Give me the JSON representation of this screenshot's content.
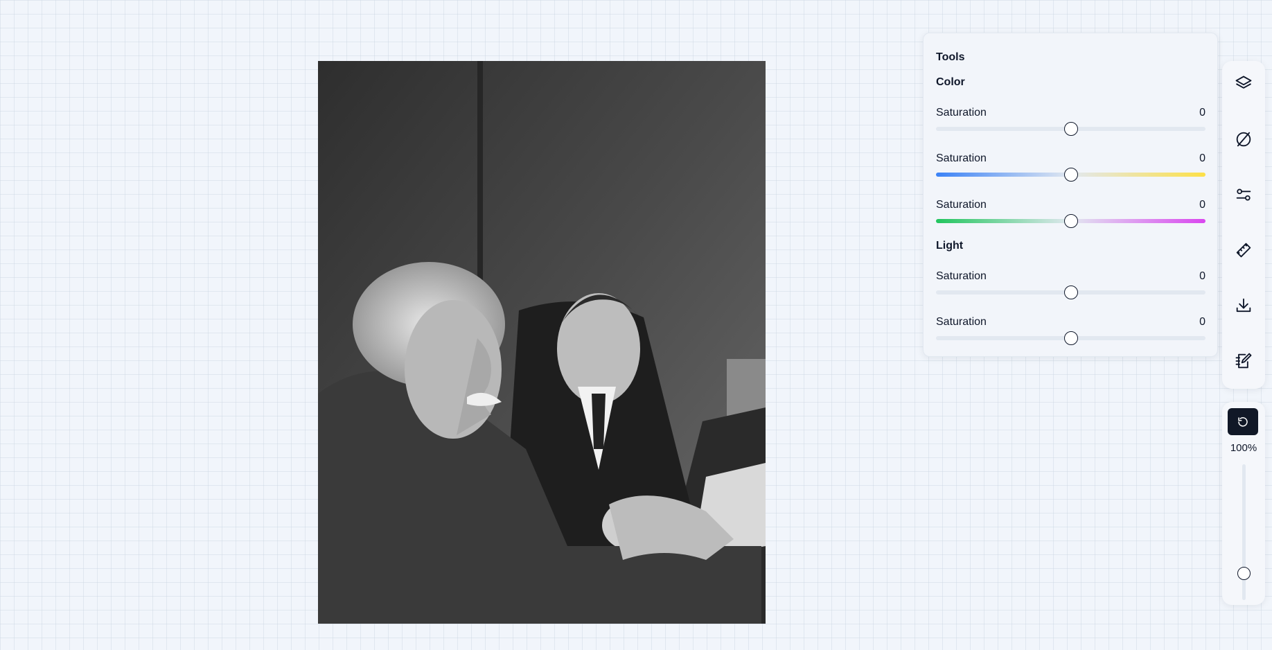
{
  "photo": {
    "alt": "Black and white photograph of two men seated at a desk reading papers"
  },
  "tools": {
    "title": "Tools",
    "sections": [
      {
        "title": "Color",
        "sliders": [
          {
            "label": "Saturation",
            "value": "0",
            "position": 0.5,
            "track": "neutral"
          },
          {
            "label": "Saturation",
            "value": "0",
            "position": 0.5,
            "track": "blue-yellow"
          },
          {
            "label": "Saturation",
            "value": "0",
            "position": 0.5,
            "track": "green-magenta"
          }
        ]
      },
      {
        "title": "Light",
        "sliders": [
          {
            "label": "Saturation",
            "value": "0",
            "position": 0.5,
            "track": "neutral"
          },
          {
            "label": "Saturation",
            "value": "0",
            "position": 0.5,
            "track": "neutral"
          }
        ]
      }
    ]
  },
  "toolbar": {
    "buttons": [
      {
        "name": "layers-icon"
      },
      {
        "name": "no-filter-icon"
      },
      {
        "name": "adjustments-icon"
      },
      {
        "name": "ruler-icon"
      },
      {
        "name": "download-icon"
      },
      {
        "name": "edit-notes-icon"
      }
    ]
  },
  "zoom": {
    "label": "100%",
    "level": 0.2,
    "reset_icon": "reset-icon"
  },
  "colors": {
    "background": "#f1f5fb",
    "accent_dark": "#111827",
    "track_neutral": "#e2e8f0",
    "blue": "#3b82f6",
    "yellow": "#fde047",
    "green": "#22c55e",
    "magenta": "#d946ef"
  }
}
